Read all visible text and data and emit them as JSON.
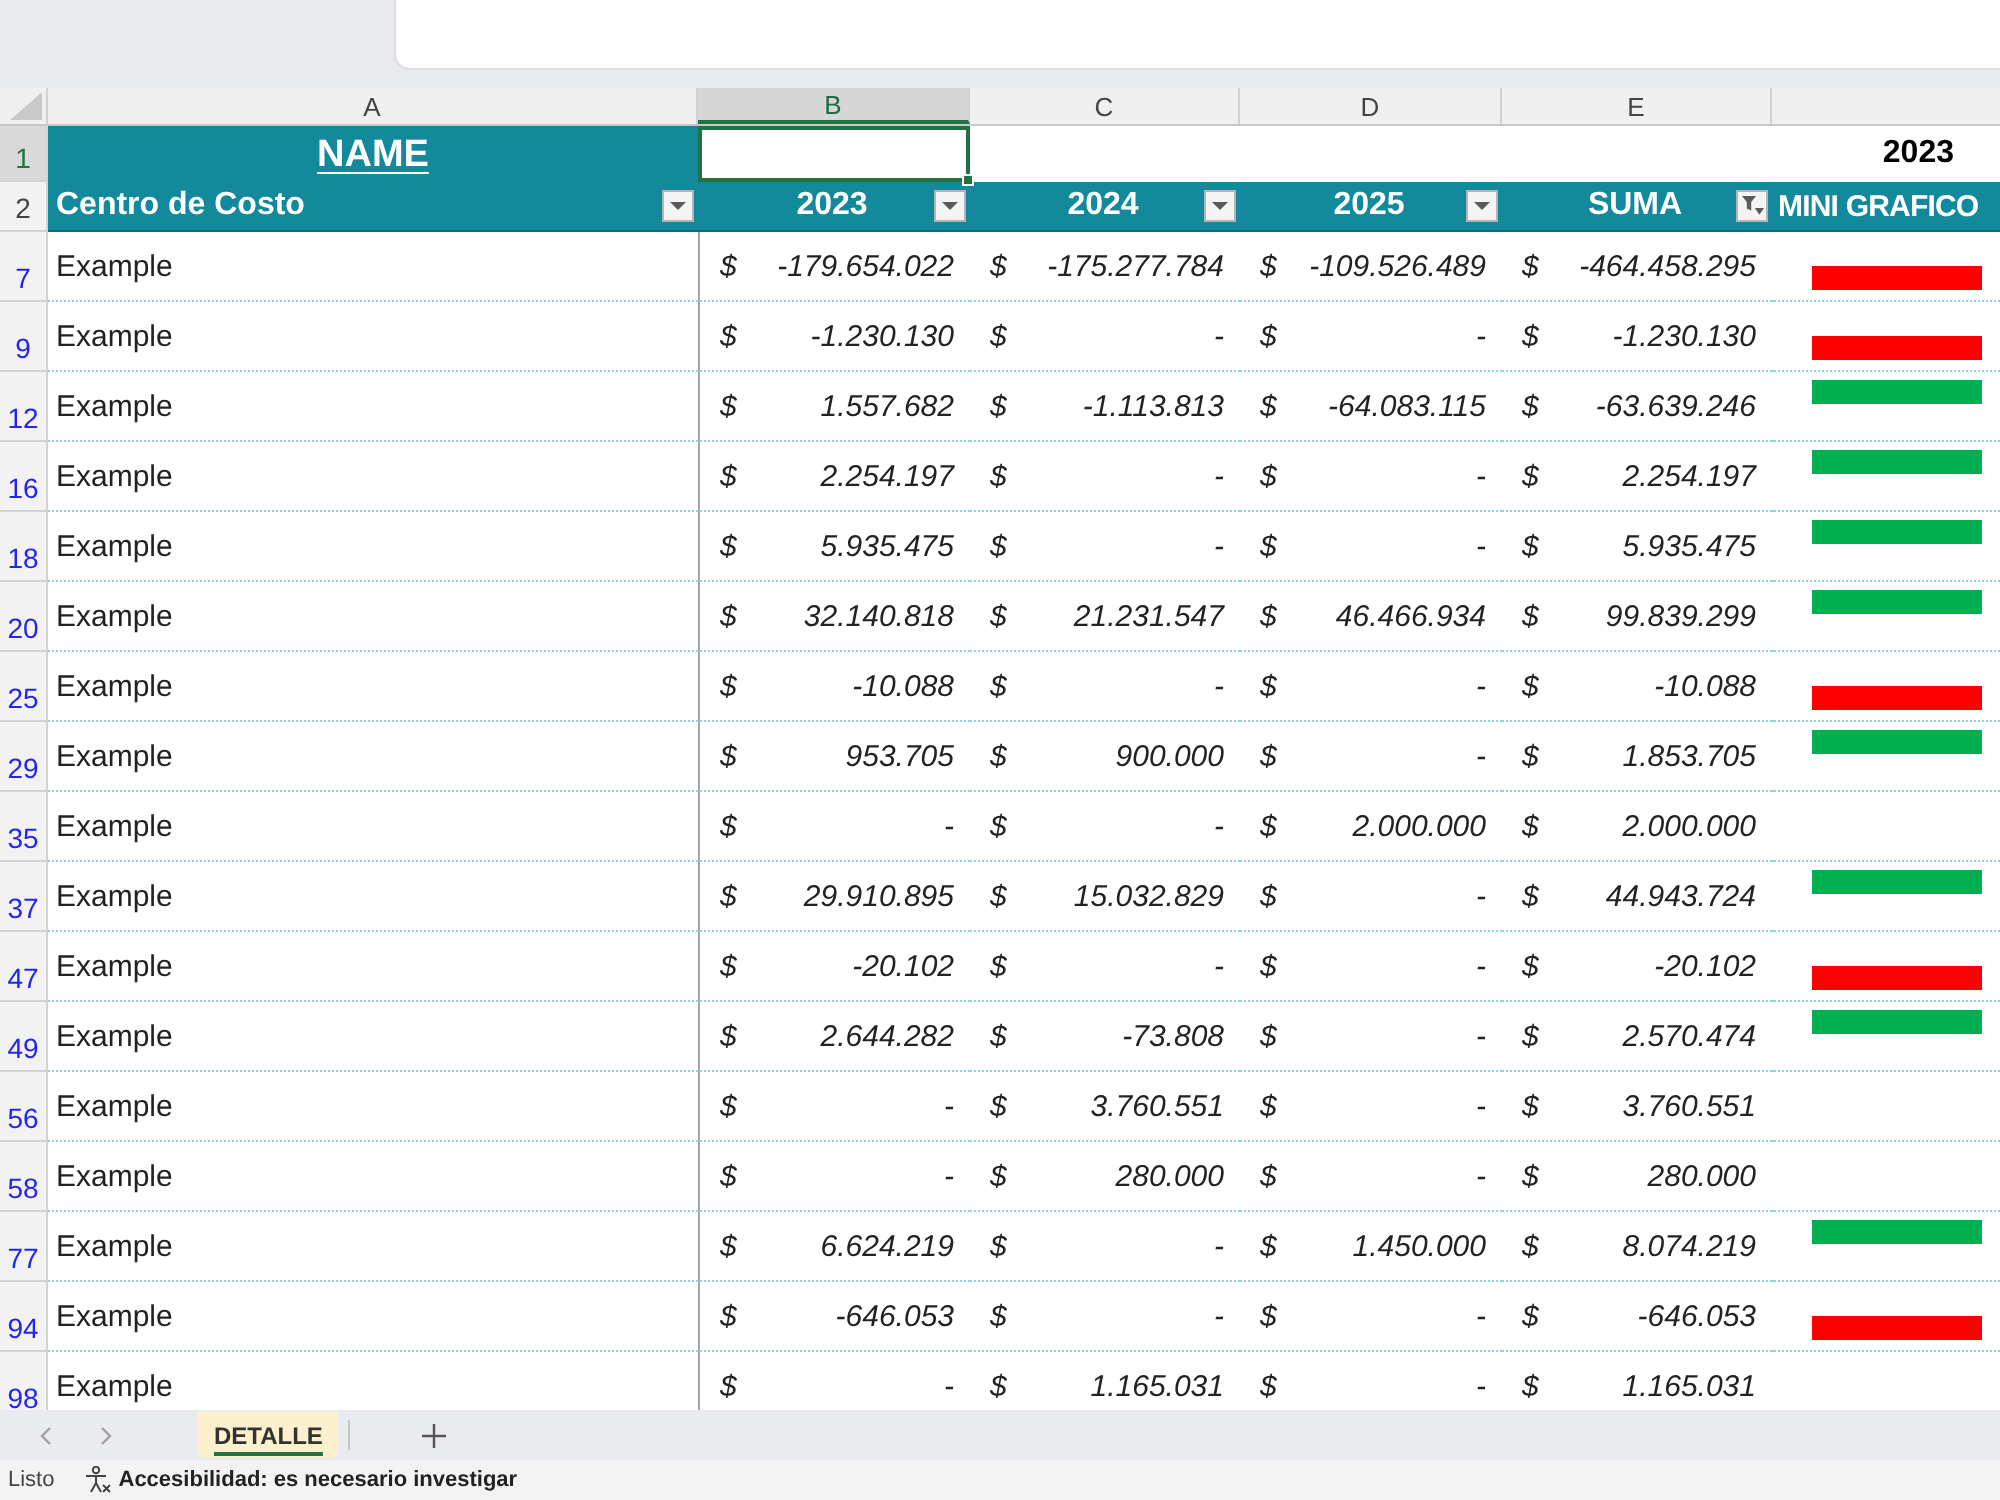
{
  "column_headers": [
    {
      "label": "A",
      "selected": false
    },
    {
      "label": "B",
      "selected": true
    },
    {
      "label": "C",
      "selected": false
    },
    {
      "label": "D",
      "selected": false
    },
    {
      "label": "E",
      "selected": false
    }
  ],
  "title_row": {
    "row_number": "1",
    "selected": true,
    "title": "NAME",
    "year": "2023"
  },
  "table": {
    "header_row": {
      "row_number": "2",
      "selected": false
    },
    "columns": [
      {
        "label": "Centro de Costo",
        "filter_button": true,
        "filtered": false
      },
      {
        "label": "2023",
        "filter_button": true,
        "filtered": false
      },
      {
        "label": "2024",
        "filter_button": true,
        "filtered": false
      },
      {
        "label": "2025",
        "filter_button": true,
        "filtered": false
      },
      {
        "label": "SUMA",
        "filter_button": true,
        "filtered": true
      },
      {
        "label": "MINI GRAFICO",
        "filter_button": false
      }
    ],
    "rows": [
      {
        "row_number": "7",
        "selected": false,
        "name": "Example",
        "amounts": [
          {
            "currency": "$",
            "value": "-179.654.022"
          },
          {
            "currency": "$",
            "value": "-175.277.784"
          },
          {
            "currency": "$",
            "value": "-109.526.489"
          },
          {
            "currency": "$",
            "value": "-464.458.295"
          }
        ],
        "sparkline_negative": true
      },
      {
        "row_number": "9",
        "selected": false,
        "name": "Example",
        "amounts": [
          {
            "currency": "$",
            "value": "-1.230.130"
          },
          {
            "currency": "$",
            "value": "-"
          },
          {
            "currency": "$",
            "value": "-"
          },
          {
            "currency": "$",
            "value": "-1.230.130"
          }
        ],
        "sparkline_negative": true
      },
      {
        "row_number": "12",
        "selected": false,
        "name": "Example",
        "amounts": [
          {
            "currency": "$",
            "value": "1.557.682"
          },
          {
            "currency": "$",
            "value": "-1.113.813"
          },
          {
            "currency": "$",
            "value": "-64.083.115"
          },
          {
            "currency": "$",
            "value": "-63.639.246"
          }
        ],
        "sparkline_negative": false
      },
      {
        "row_number": "16",
        "selected": false,
        "name": "Example",
        "amounts": [
          {
            "currency": "$",
            "value": "2.254.197"
          },
          {
            "currency": "$",
            "value": "-"
          },
          {
            "currency": "$",
            "value": "-"
          },
          {
            "currency": "$",
            "value": "2.254.197"
          }
        ],
        "sparkline_negative": false
      },
      {
        "row_number": "18",
        "selected": false,
        "name": "Example",
        "amounts": [
          {
            "currency": "$",
            "value": "5.935.475"
          },
          {
            "currency": "$",
            "value": "-"
          },
          {
            "currency": "$",
            "value": "-"
          },
          {
            "currency": "$",
            "value": "5.935.475"
          }
        ],
        "sparkline_negative": false
      },
      {
        "row_number": "20",
        "selected": false,
        "name": "Example",
        "amounts": [
          {
            "currency": "$",
            "value": "32.140.818"
          },
          {
            "currency": "$",
            "value": "21.231.547"
          },
          {
            "currency": "$",
            "value": "46.466.934"
          },
          {
            "currency": "$",
            "value": "99.839.299"
          }
        ],
        "sparkline_negative": false
      },
      {
        "row_number": "25",
        "selected": false,
        "name": "Example",
        "amounts": [
          {
            "currency": "$",
            "value": "-10.088"
          },
          {
            "currency": "$",
            "value": "-"
          },
          {
            "currency": "$",
            "value": "-"
          },
          {
            "currency": "$",
            "value": "-10.088"
          }
        ],
        "sparkline_negative": true
      },
      {
        "row_number": "29",
        "selected": false,
        "name": "Example",
        "amounts": [
          {
            "currency": "$",
            "value": "953.705"
          },
          {
            "currency": "$",
            "value": "900.000"
          },
          {
            "currency": "$",
            "value": "-"
          },
          {
            "currency": "$",
            "value": "1.853.705"
          }
        ],
        "sparkline_negative": false
      },
      {
        "row_number": "35",
        "selected": false,
        "name": "Example",
        "amounts": [
          {
            "currency": "$",
            "value": "-"
          },
          {
            "currency": "$",
            "value": "-"
          },
          {
            "currency": "$",
            "value": "2.000.000"
          },
          {
            "currency": "$",
            "value": "2.000.000"
          }
        ]
      },
      {
        "row_number": "37",
        "selected": false,
        "name": "Example",
        "amounts": [
          {
            "currency": "$",
            "value": "29.910.895"
          },
          {
            "currency": "$",
            "value": "15.032.829"
          },
          {
            "currency": "$",
            "value": "-"
          },
          {
            "currency": "$",
            "value": "44.943.724"
          }
        ],
        "sparkline_negative": false
      },
      {
        "row_number": "47",
        "selected": false,
        "name": "Example",
        "amounts": [
          {
            "currency": "$",
            "value": "-20.102"
          },
          {
            "currency": "$",
            "value": "-"
          },
          {
            "currency": "$",
            "value": "-"
          },
          {
            "currency": "$",
            "value": "-20.102"
          }
        ],
        "sparkline_negative": true
      },
      {
        "row_number": "49",
        "selected": false,
        "name": "Example",
        "amounts": [
          {
            "currency": "$",
            "value": "2.644.282"
          },
          {
            "currency": "$",
            "value": "-73.808"
          },
          {
            "currency": "$",
            "value": "-"
          },
          {
            "currency": "$",
            "value": "2.570.474"
          }
        ],
        "sparkline_negative": false
      },
      {
        "row_number": "56",
        "selected": false,
        "name": "Example",
        "amounts": [
          {
            "currency": "$",
            "value": "-"
          },
          {
            "currency": "$",
            "value": "3.760.551"
          },
          {
            "currency": "$",
            "value": "-"
          },
          {
            "currency": "$",
            "value": "3.760.551"
          }
        ]
      },
      {
        "row_number": "58",
        "selected": false,
        "name": "Example",
        "amounts": [
          {
            "currency": "$",
            "value": "-"
          },
          {
            "currency": "$",
            "value": "280.000"
          },
          {
            "currency": "$",
            "value": "-"
          },
          {
            "currency": "$",
            "value": "280.000"
          }
        ]
      },
      {
        "row_number": "77",
        "selected": false,
        "name": "Example",
        "amounts": [
          {
            "currency": "$",
            "value": "6.624.219"
          },
          {
            "currency": "$",
            "value": "-"
          },
          {
            "currency": "$",
            "value": "1.450.000"
          },
          {
            "currency": "$",
            "value": "8.074.219"
          }
        ],
        "sparkline_negative": false
      },
      {
        "row_number": "94",
        "selected": false,
        "name": "Example",
        "amounts": [
          {
            "currency": "$",
            "value": "-646.053"
          },
          {
            "currency": "$",
            "value": "-"
          },
          {
            "currency": "$",
            "value": "-"
          },
          {
            "currency": "$",
            "value": "-646.053"
          }
        ],
        "sparkline_negative": true
      },
      {
        "row_number": "98",
        "selected": false,
        "name": "Example",
        "amounts": [
          {
            "currency": "$",
            "value": "-"
          },
          {
            "currency": "$",
            "value": "1.165.031"
          },
          {
            "currency": "$",
            "value": "-"
          },
          {
            "currency": "$",
            "value": "1.165.031"
          }
        ]
      }
    ]
  },
  "sheet_tabs": [
    {
      "label": "DETALLE",
      "selected": true
    }
  ],
  "status_bar": {
    "mode": "Listo",
    "accessibility": "Accesibilidad: es necesario investigar"
  }
}
